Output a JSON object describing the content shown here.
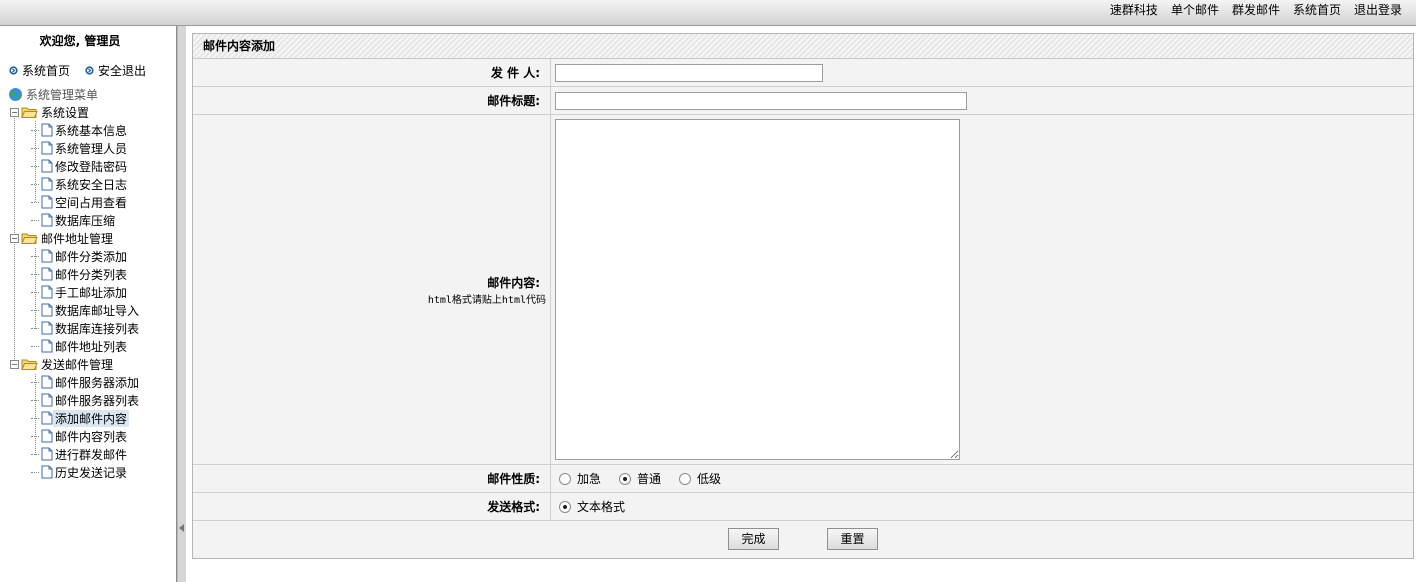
{
  "topnav": {
    "items": [
      "速群科技",
      "单个邮件",
      "群发邮件",
      "系统首页",
      "退出登录"
    ]
  },
  "sidebar": {
    "welcome": "欢迎您, 管理员",
    "quick_links": [
      "系统首页",
      "安全退出"
    ],
    "tree_root": "系统管理菜单",
    "groups": [
      {
        "label": "系统设置",
        "items": [
          "系统基本信息",
          "系统管理人员",
          "修改登陆密码",
          "系统安全日志",
          "空间占用查看",
          "数据库压缩"
        ]
      },
      {
        "label": "邮件地址管理",
        "items": [
          "邮件分类添加",
          "邮件分类列表",
          "手工邮址添加",
          "数据库邮址导入",
          "数据库连接列表",
          "邮件地址列表"
        ]
      },
      {
        "label": "发送邮件管理",
        "items": [
          "邮件服务器添加",
          "邮件服务器列表",
          "添加邮件内容",
          "邮件内容列表",
          "进行群发邮件",
          "历史发送记录"
        ]
      }
    ],
    "selected_item": "添加邮件内容"
  },
  "panel": {
    "title": "邮件内容添加",
    "sender_label": "发 件 人:",
    "sender_value": "",
    "subject_label": "邮件标题:",
    "subject_value": "",
    "content_label": "邮件内容:",
    "content_hint": "html格式请贴上html代码",
    "content_value": "",
    "priority_label": "邮件性质:",
    "priority_options": [
      "加急",
      "普通",
      "低级"
    ],
    "priority_selected": "普通",
    "format_label": "发送格式:",
    "format_options": [
      "文本格式"
    ],
    "format_selected": "文本格式",
    "submit_label": "完成",
    "reset_label": "重置"
  }
}
